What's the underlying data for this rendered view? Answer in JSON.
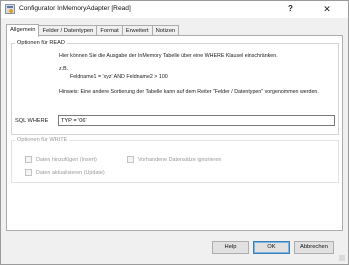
{
  "window": {
    "title": "Configurator InMemoryAdapter [Read]",
    "help_glyph": "?",
    "close_glyph": "✕"
  },
  "tabs": [
    {
      "label": "Allgemein",
      "active": true
    },
    {
      "label": "Felder / Datentypen",
      "active": false
    },
    {
      "label": "Format",
      "active": false
    },
    {
      "label": "Erweitert",
      "active": false
    },
    {
      "label": "Notizen",
      "active": false
    }
  ],
  "read_group": {
    "legend": "Optionen für READ",
    "description": "Hier können Sie die Ausgabe der InMemory Tabelle über eine WHERE Klausel einschränken.",
    "example_label": "z.B.",
    "example_expr": "Feldname1 = 'xyz' AND Feldname2  > 100",
    "hint": "Hinweis: Eine andere Sortierung der Tabelle kann auf dem Reiter \"Felder / Datentypen\" vorgenommen werden.",
    "sql_label": "SQL WHERE",
    "sql_value": "TYP = '06'"
  },
  "write_group": {
    "legend": "Optionen für WRITE",
    "checkboxes": [
      {
        "label": "Daten hinzufügen (Insert)",
        "checked": false,
        "enabled": false
      },
      {
        "label": "Vorhandene Datensätze ignorieren",
        "checked": false,
        "enabled": false
      },
      {
        "label": "Daten aktualisieren (Update)",
        "checked": false,
        "enabled": false
      }
    ]
  },
  "buttons": {
    "help": "Help",
    "ok": "OK",
    "cancel": "Abbrechen"
  }
}
